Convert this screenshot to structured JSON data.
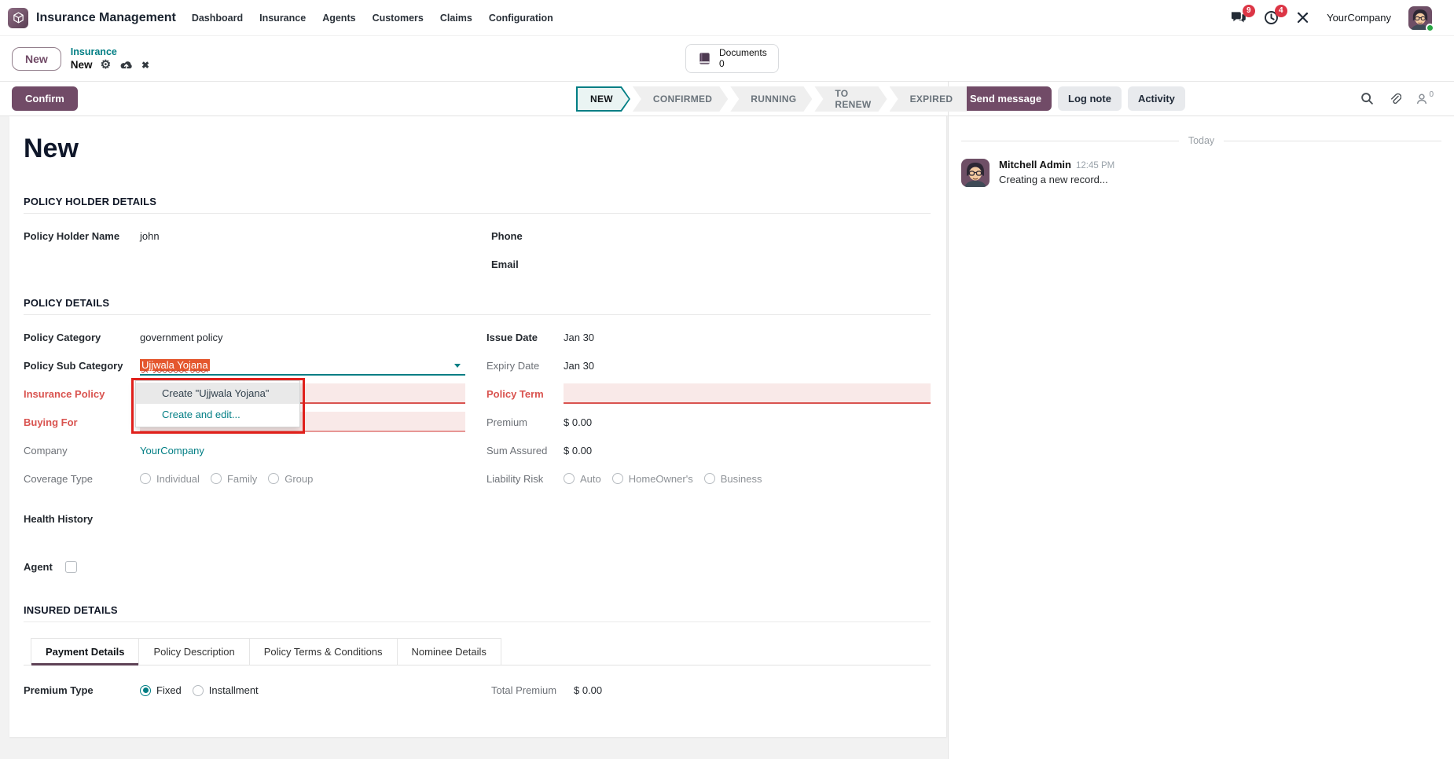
{
  "navbar": {
    "brand": "Insurance Management",
    "menu": [
      "Dashboard",
      "Insurance",
      "Agents",
      "Customers",
      "Claims",
      "Configuration"
    ],
    "messages_badge": "9",
    "activities_badge": "4",
    "company": "YourCompany"
  },
  "control_panel": {
    "new_button": "New",
    "breadcrumb_parent": "Insurance",
    "breadcrumb_current": "New",
    "documents_button": {
      "label": "Documents",
      "count": "0"
    },
    "confirm_button": "Confirm",
    "statusbar": [
      "NEW",
      "CONFIRMED",
      "RUNNING",
      "TO RENEW",
      "EXPIRED"
    ],
    "active_status": "NEW"
  },
  "chatter": {
    "send_message": "Send message",
    "log_note": "Log note",
    "activity": "Activity",
    "followers_count": "0",
    "date_divider": "Today",
    "message": {
      "author": "Mitchell Admin",
      "time": "12:45 PM",
      "body": "Creating a new record..."
    }
  },
  "form": {
    "title": "New",
    "sections": {
      "policy_holder": "POLICY HOLDER DETAILS",
      "policy_details": "POLICY DETAILS",
      "insured_details": "INSURED DETAILS"
    },
    "fields": {
      "policy_holder_name": {
        "label": "Policy Holder Name",
        "value": "john"
      },
      "phone": {
        "label": "Phone",
        "value": ""
      },
      "email": {
        "label": "Email",
        "value": ""
      },
      "policy_category": {
        "label": "Policy Category",
        "value": "government policy"
      },
      "policy_sub_category": {
        "label": "Policy Sub Category",
        "value": "Ujjwala Yojana"
      },
      "insurance_policy": {
        "label": "Insurance Policy",
        "value": ""
      },
      "buying_for": {
        "label": "Buying For",
        "value": ""
      },
      "company": {
        "label": "Company",
        "value": "YourCompany"
      },
      "coverage_type": {
        "label": "Coverage Type",
        "options": [
          "Individual",
          "Family",
          "Group"
        ]
      },
      "health_history": {
        "label": "Health History"
      },
      "agent": {
        "label": "Agent"
      },
      "issue_date": {
        "label": "Issue Date",
        "value": "Jan 30"
      },
      "expiry_date": {
        "label": "Expiry Date",
        "value": "Jan 30"
      },
      "policy_term": {
        "label": "Policy Term",
        "value": ""
      },
      "premium": {
        "label": "Premium",
        "value": "$ 0.00"
      },
      "sum_assured": {
        "label": "Sum Assured",
        "value": "$ 0.00"
      },
      "liability_risk": {
        "label": "Liability Risk",
        "options": [
          "Auto",
          "HomeOwner's",
          "Business"
        ]
      }
    },
    "dropdown": {
      "items": [
        "Create \"Ujjwala Yojana\"",
        "Create and edit..."
      ]
    },
    "tabs": [
      "Payment Details",
      "Policy Description",
      "Policy Terms & Conditions",
      "Nominee Details"
    ],
    "active_tab": "Payment Details",
    "payment": {
      "premium_type": {
        "label": "Premium Type",
        "options": [
          "Fixed",
          "Installment"
        ],
        "selected": "Fixed"
      },
      "total_premium": {
        "label": "Total Premium",
        "value": "$ 0.00"
      }
    }
  },
  "colors": {
    "brand": "#714B67",
    "link": "#017E84",
    "danger": "#D9534F",
    "selection": "#E4572E",
    "annotation": "#E0201B"
  }
}
